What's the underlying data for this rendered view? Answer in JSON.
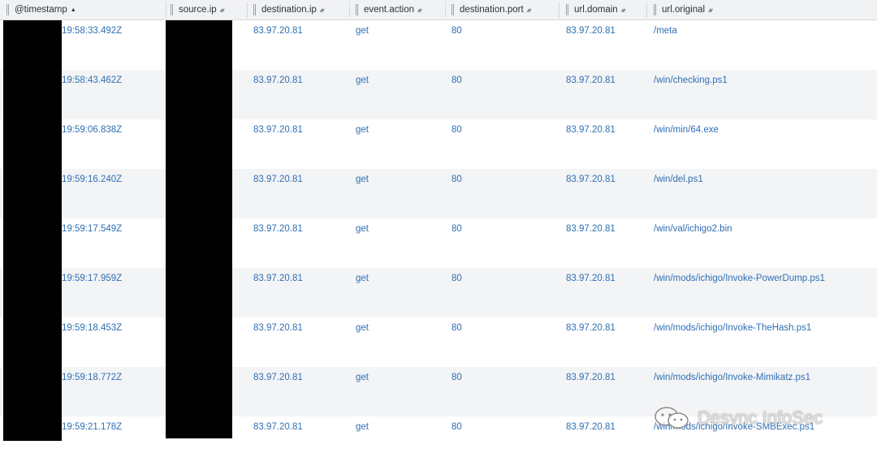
{
  "columns": [
    {
      "label": "@timestamp",
      "sort": "asc"
    },
    {
      "label": "source.ip",
      "sort": "both"
    },
    {
      "label": "destination.ip",
      "sort": "both"
    },
    {
      "label": "event.action",
      "sort": "both"
    },
    {
      "label": "destination.port",
      "sort": "both"
    },
    {
      "label": "url.domain",
      "sort": "both"
    },
    {
      "label": "url.original",
      "sort": "both"
    }
  ],
  "rows": [
    {
      "timestamp": "19:58:33.492Z",
      "destination_ip": "83.97.20.81",
      "action": "get",
      "port": "80",
      "domain": "83.97.20.81",
      "url": "/meta"
    },
    {
      "timestamp": "19:58:43.462Z",
      "destination_ip": "83.97.20.81",
      "action": "get",
      "port": "80",
      "domain": "83.97.20.81",
      "url": "/win/checking.ps1"
    },
    {
      "timestamp": "19:59:06.838Z",
      "destination_ip": "83.97.20.81",
      "action": "get",
      "port": "80",
      "domain": "83.97.20.81",
      "url": "/win/min/64.exe"
    },
    {
      "timestamp": "19:59:16.240Z",
      "destination_ip": "83.97.20.81",
      "action": "get",
      "port": "80",
      "domain": "83.97.20.81",
      "url": "/win/del.ps1"
    },
    {
      "timestamp": "19:59:17.549Z",
      "destination_ip": "83.97.20.81",
      "action": "get",
      "port": "80",
      "domain": "83.97.20.81",
      "url": "/win/val/ichigo2.bin"
    },
    {
      "timestamp": "19:59:17.959Z",
      "destination_ip": "83.97.20.81",
      "action": "get",
      "port": "80",
      "domain": "83.97.20.81",
      "url": "/win/mods/ichigo/Invoke-PowerDump.ps1"
    },
    {
      "timestamp": "19:59:18.453Z",
      "destination_ip": "83.97.20.81",
      "action": "get",
      "port": "80",
      "domain": "83.97.20.81",
      "url": "/win/mods/ichigo/Invoke-TheHash.ps1"
    },
    {
      "timestamp": "19:59:18.772Z",
      "destination_ip": "83.97.20.81",
      "action": "get",
      "port": "80",
      "domain": "83.97.20.81",
      "url": "/win/mods/ichigo/Invoke-Mimikatz.ps1"
    },
    {
      "timestamp": "19:59:21.178Z",
      "destination_ip": "83.97.20.81",
      "action": "get",
      "port": "80",
      "domain": "83.97.20.81",
      "url": "/win/mods/ichigo/Invoke-SMBExec.ps1"
    }
  ],
  "watermark": {
    "text": "Desync InfoSec",
    "icon": "wechat-icon"
  },
  "colors": {
    "link": "#2f6fb4",
    "header_bg": "#f1f2f4",
    "row_alt_bg": "#f3f4f6",
    "redaction": "#000000"
  }
}
